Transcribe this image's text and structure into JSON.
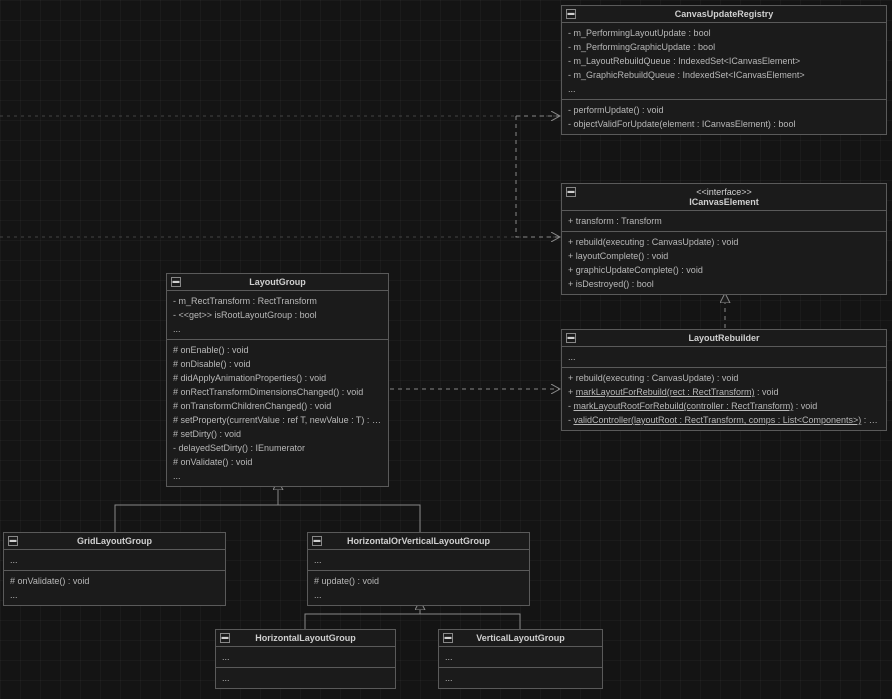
{
  "canvasUpdateRegistry": {
    "name": "CanvasUpdateRegistry",
    "attrs": [
      "- m_PerformingLayoutUpdate : bool",
      "- m_PerformingGraphicUpdate : bool",
      "- m_LayoutRebuildQueue : IndexedSet<ICanvasElement>",
      "- m_GraphicRebuildQueue : IndexedSet<ICanvasElement>",
      "..."
    ],
    "ops": [
      "- performUpdate() : void",
      "- objectValidForUpdate(element : ICanvasElement) : bool"
    ]
  },
  "iCanvasElement": {
    "stereotype": "<<interface>>",
    "name": "ICanvasElement",
    "attrs": [
      "+ transform : Transform"
    ],
    "ops": [
      "+ rebuild(executing : CanvasUpdate) : void",
      "+ layoutComplete() : void",
      "+ graphicUpdateComplete() : void",
      "+ isDestroyed() : bool"
    ]
  },
  "layoutRebuilder": {
    "name": "LayoutRebuilder",
    "attrs": [
      "..."
    ],
    "ops": {
      "l1": {
        "pre": "+ rebuild(executing : CanvasUpdate) : void"
      },
      "l2": {
        "pre": "+ ",
        "u": "markLayoutForRebuild(rect : RectTransform)",
        "post": " : void"
      },
      "l3": {
        "pre": "- ",
        "u": "markLayoutRootForRebuild(controller : RectTransform)",
        "post": " : void"
      },
      "l4": {
        "pre": "- ",
        "u": "validController(layoutRoot : RectTransform, comps : List<Components>)",
        "post": " : bool"
      }
    }
  },
  "layoutGroup": {
    "name": "LayoutGroup",
    "attrs": [
      "- m_RectTransform : RectTransform",
      "- <<get>> isRootLayoutGroup : bool",
      "..."
    ],
    "ops": [
      "# onEnable() : void",
      "# onDisable() : void",
      "# didApplyAnimationProperties() : void",
      "# onRectTransformDimensionsChanged() : void",
      "# onTransformChildrenChanged() : void",
      "# setProperty(currentValue : ref T, newValue : T) : void",
      "# setDirty() : void",
      "- delayedSetDirty() : IEnumerator",
      "# onValidate() : void",
      "..."
    ]
  },
  "gridLayoutGroup": {
    "name": "GridLayoutGroup",
    "attrs": [
      "..."
    ],
    "ops": [
      "# onValidate() : void",
      "..."
    ]
  },
  "horizOrVert": {
    "name": "HorizontalOrVerticalLayoutGroup",
    "attrs": [
      "..."
    ],
    "ops": [
      "# update() : void",
      "..."
    ]
  },
  "horizontal": {
    "name": "HorizontalLayoutGroup",
    "attrs": [
      "..."
    ],
    "ops": [
      "..."
    ]
  },
  "vertical": {
    "name": "VerticalLayoutGroup",
    "attrs": [
      "..."
    ],
    "ops": [
      "..."
    ]
  },
  "collapseIcon": "▬"
}
